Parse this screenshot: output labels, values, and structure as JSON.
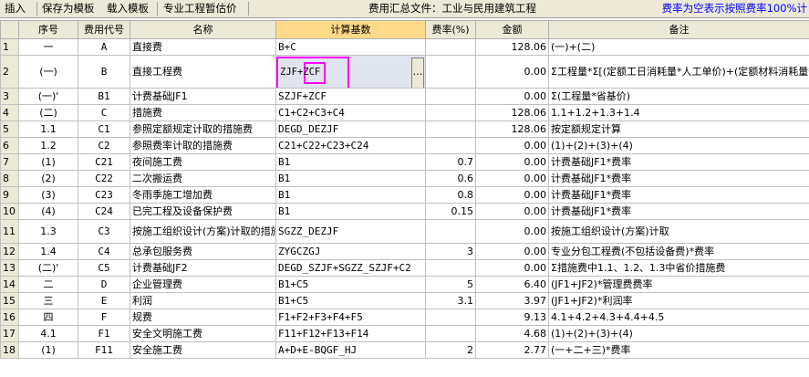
{
  "toolbar": {
    "insert": "插入",
    "save_template": "保存为模板",
    "load_template": "载入模板",
    "pro_project": "专业工程暂估价",
    "file_label": "费用汇总文件：工业与民用建筑工程",
    "notice": "费率为空表示按照费率100%计"
  },
  "columns": {
    "no": "序号",
    "code": "费用代号",
    "name": "名称",
    "base": "计算基数",
    "rate": "费率(%)",
    "amount": "金额",
    "note": "备注"
  },
  "rows": [
    {
      "rn": "1",
      "no": "一",
      "code": "A",
      "name": "直接费",
      "base": "B+C",
      "rate": "",
      "amount": "128.06",
      "note": "(一)+(二)"
    },
    {
      "rn": "2",
      "no": "(一)",
      "code": "B",
      "name": "直接工程费",
      "base": "ZJF+ZCF",
      "rate": "",
      "amount": "0.00",
      "note": "Σ工程量*Σ[(定额工日消耗量*人工单价)+(定额材料消耗量*材料单价)+(定额机械台班消耗量*机械台班单价)]"
    },
    {
      "rn": "3",
      "no": "(一)'",
      "code": "B1",
      "name": "计费基础JF1",
      "base": "SZJF+ZCF",
      "rate": "",
      "amount": "0.00",
      "note": "Σ(工程量*省基价)"
    },
    {
      "rn": "4",
      "no": "(二)",
      "code": "C",
      "name": "措施费",
      "base": "C1+C2+C3+C4",
      "rate": "",
      "amount": "128.06",
      "note": "1.1+1.2+1.3+1.4"
    },
    {
      "rn": "5",
      "no": "1.1",
      "code": "C1",
      "name": "参照定额规定计取的措施费",
      "base": "DEGD_DEZJF",
      "rate": "",
      "amount": "128.06",
      "note": "按定额规定计算"
    },
    {
      "rn": "6",
      "no": "1.2",
      "code": "C2",
      "name": "参照费率计取的措施费",
      "base": "C21+C22+C23+C24",
      "rate": "",
      "amount": "0.00",
      "note": "(1)+(2)+(3)+(4)"
    },
    {
      "rn": "7",
      "no": "(1)",
      "code": "C21",
      "name": "夜间施工费",
      "base": "B1",
      "rate": "0.7",
      "amount": "0.00",
      "note": "计费基础JF1*费率"
    },
    {
      "rn": "8",
      "no": "(2)",
      "code": "C22",
      "name": "二次搬运费",
      "base": "B1",
      "rate": "0.6",
      "amount": "0.00",
      "note": "计费基础JF1*费率"
    },
    {
      "rn": "9",
      "no": "(3)",
      "code": "C23",
      "name": "冬雨季施工增加费",
      "base": "B1",
      "rate": "0.8",
      "amount": "0.00",
      "note": "计费基础JF1*费率"
    },
    {
      "rn": "10",
      "no": "(4)",
      "code": "C24",
      "name": "已完工程及设备保护费",
      "base": "B1",
      "rate": "0.15",
      "amount": "0.00",
      "note": "计费基础JF1*费率"
    },
    {
      "rn": "11",
      "no": "1.3",
      "code": "C3",
      "name": "按施工组织设计(方案)计取的措施费",
      "base": "SGZZ_DEZJF",
      "rate": "",
      "amount": "0.00",
      "note": "按施工组织设计(方案)计取"
    },
    {
      "rn": "12",
      "no": "1.4",
      "code": "C4",
      "name": "总承包服务费",
      "base": "ZYGCZGJ",
      "rate": "3",
      "amount": "0.00",
      "note": "专业分包工程费(不包括设备费)*费率"
    },
    {
      "rn": "13",
      "no": "(二)'",
      "code": "C5",
      "name": "计费基础JF2",
      "base": "DEGD_SZJF+SGZZ_SZJF+C2",
      "rate": "",
      "amount": "0.00",
      "note": "Σ措施费中1.1、1.2、1.3中省价措施费"
    },
    {
      "rn": "14",
      "no": "二",
      "code": "D",
      "name": "企业管理费",
      "base": "B1+C5",
      "rate": "5",
      "amount": "6.40",
      "note": "(JF1+JF2)*管理费费率"
    },
    {
      "rn": "15",
      "no": "三",
      "code": "E",
      "name": "利润",
      "base": "B1+C5",
      "rate": "3.1",
      "amount": "3.97",
      "note": "(JF1+JF2)*利润率"
    },
    {
      "rn": "16",
      "no": "四",
      "code": "F",
      "name": "规费",
      "base": "F1+F2+F3+F4+F5",
      "rate": "",
      "amount": "9.13",
      "note": "4.1+4.2+4.3+4.4+4.5"
    },
    {
      "rn": "17",
      "no": "4.1",
      "code": "F1",
      "name": "安全文明施工费",
      "base": "F11+F12+F13+F14",
      "rate": "",
      "amount": "4.68",
      "note": "(1)+(2)+(3)+(4)"
    },
    {
      "rn": "18",
      "no": "(1)",
      "code": "F11",
      "name": "安全施工费",
      "base": "A+D+E-BQGF_HJ",
      "rate": "2",
      "amount": "2.77",
      "note": "(一+二+三)*费率"
    }
  ]
}
